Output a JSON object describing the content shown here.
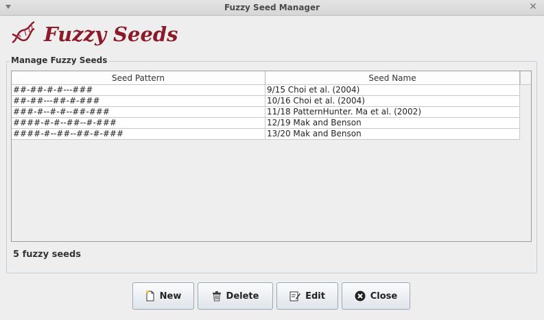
{
  "window": {
    "title": "Fuzzy Seed Manager"
  },
  "header": {
    "app_title": "Fuzzy Seeds",
    "logo_icon": "dna-helix-icon"
  },
  "group": {
    "label": "Manage Fuzzy Seeds"
  },
  "table": {
    "columns": [
      "Seed Pattern",
      "Seed Name"
    ],
    "rows": [
      {
        "pattern": "##-##-#-#---###",
        "name": "9/15 Choi et al. (2004)"
      },
      {
        "pattern": "##-##---##-#-###",
        "name": "10/16 Choi et al. (2004)"
      },
      {
        "pattern": "###-#--#-#--##-###",
        "name": "11/18 PatternHunter. Ma et al. (2002)"
      },
      {
        "pattern": "####-#-#--##--#-###",
        "name": "12/19 Mak and Benson"
      },
      {
        "pattern": "####-#--##--##-#-###",
        "name": "13/20 Mak and Benson"
      }
    ]
  },
  "status": {
    "count_text": "5 fuzzy seeds"
  },
  "buttons": {
    "new": {
      "label": "New",
      "icon": "new-document-icon"
    },
    "delete": {
      "label": "Delete",
      "icon": "trash-icon"
    },
    "edit": {
      "label": "Edit",
      "icon": "edit-icon"
    },
    "close": {
      "label": "Close",
      "icon": "close-circle-icon"
    }
  },
  "colors": {
    "brand": "#8b1a2a",
    "window_bg": "#eeeeee",
    "button_border": "#9aa8b8"
  }
}
